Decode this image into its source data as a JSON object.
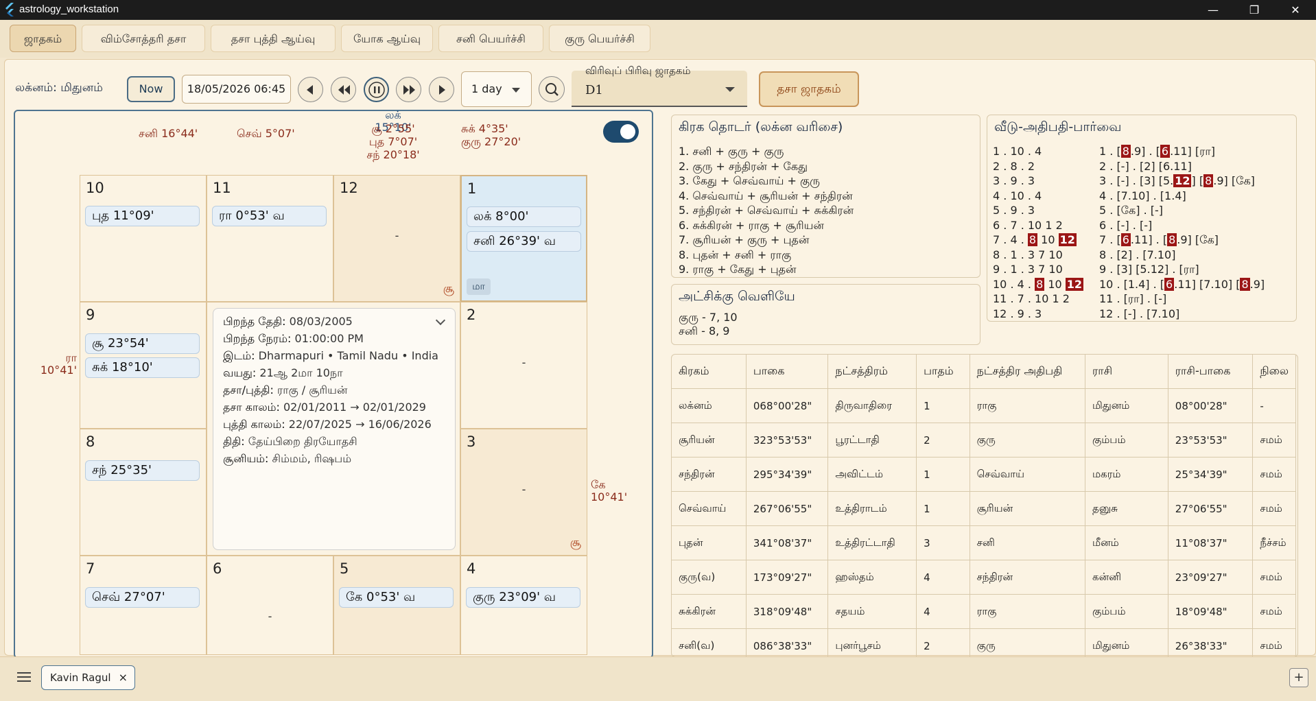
{
  "window": {
    "title": "astrology_workstation",
    "min": "—",
    "max": "❐",
    "close": "✕"
  },
  "tabs": [
    "ஜாதகம்",
    "விம்சோத்தரி தசா",
    "தசா புத்தி ஆய்வு",
    "யோக ஆய்வு",
    "சனி பெயர்ச்சி",
    "குரு பெயர்ச்சி"
  ],
  "toolbar": {
    "lagna_label": "லக்னம்: மிதுனம்",
    "now_label": "Now",
    "datetime": "18/05/2026 06:45",
    "step": "1 day",
    "varga_label": "விரிவுப் பிரிவு ஜாதகம்",
    "varga_value": "D1",
    "dasa_button": "தசா ஜாதகம்"
  },
  "chart": {
    "outer": {
      "top_left1": "சனி 16°44'",
      "top_left2": "செவ் 5°07'",
      "top_mid": [
        "லக் 15°10'",
        "சூ 2°55'",
        "புத 7°07'",
        "சந் 20°18'"
      ],
      "top_right": [
        "சுக் 4°35'",
        "குரு 27°20'"
      ],
      "left": [
        "ரா",
        "10°41'"
      ],
      "right": [
        "கே",
        "10°41'"
      ]
    },
    "houses": {
      "h10": {
        "num": "10",
        "chips": [
          "புத 11°09'"
        ]
      },
      "h11": {
        "num": "11",
        "chips": [
          "ரா 0°53' வ"
        ]
      },
      "h12": {
        "num": "12",
        "dash": "-",
        "corner": "சூ"
      },
      "h1": {
        "num": "1",
        "chips": [
          "லக் 8°00'",
          "சனி 26°39' வ"
        ],
        "badge": "மா"
      },
      "h9": {
        "num": "9",
        "chips": [
          "சூ 23°54'",
          "சுக் 18°10'"
        ]
      },
      "h2": {
        "num": "2",
        "dash": "-"
      },
      "h8": {
        "num": "8",
        "chips": [
          "சந் 25°35'"
        ]
      },
      "h3": {
        "num": "3",
        "dash": "-",
        "corner": "சூ"
      },
      "h7": {
        "num": "7",
        "chips": [
          "செவ் 27°07'"
        ]
      },
      "h6": {
        "num": "6",
        "dash": "-"
      },
      "h5": {
        "num": "5",
        "chips": [
          "கே 0°53' வ"
        ]
      },
      "h4": {
        "num": "4",
        "chips": [
          "குரு 23°09' வ"
        ]
      }
    },
    "info": {
      "dob_k": "பிறந்த தேதி:",
      "dob_v": "08/03/2005",
      "tob_k": "பிறந்த நேரம்:",
      "tob_v": "01:00:00 PM",
      "place_k": "இடம்:",
      "place_v": "Dharmapuri • Tamil Nadu • India",
      "age_k": "வயது:",
      "age_v": "21ஆ 2மா 10நா",
      "dasa_k": "தசா/புத்தி:",
      "dasa_v": "ராகு / சூரியன்",
      "dasaperiod_k": "தசா காலம்:",
      "dasaperiod_v": "02/01/2011 → 02/01/2029",
      "bhukti_k": "புத்தி காலம்:",
      "bhukti_v": "22/07/2025 → 16/06/2026",
      "tithi_k": "திதி:",
      "tithi_v": "தேய்பிறை திரயோதசி",
      "sunya_k": "சூனியம்:",
      "sunya_v": "சிம்மம், ரிஷபம்"
    }
  },
  "graha_thodar": {
    "title": "கிரக தொடர் (லக்ன வரிசை)",
    "items": [
      "1. சனி + குரு + குரு",
      "2. குரு + சந்திரன் + கேது",
      "3. கேது + செவ்வாய் + குரு",
      "4. செவ்வாய் + சூரியன் + சந்திரன்",
      "5. சந்திரன் + செவ்வாய் + சுக்கிரன்",
      "6. சுக்கிரன் + ராகு + சூரியன்",
      "7. சூரியன் + குரு + புதன்",
      "8. புதன் + சனி + ராகு",
      "9. ராகு + கேது + புதன்"
    ]
  },
  "atchikku": {
    "title": "அட்சிக்கு வெளியே",
    "items": [
      "குரு - 7, 10",
      "சனி - 8, 9"
    ]
  },
  "veedu": {
    "title": "வீடு-அதிபதி-பார்வை",
    "left": [
      "1 . 10 . 4",
      "2 . 8 . 2",
      "3 . 9 . 3",
      "4 . 10 . 4",
      "5 . 9 . 3",
      "6 . 7 . 10 1 2",
      "7 . 4 .",
      "8 . 1 . 3 7 10",
      "9 . 1 . 3 7 10",
      "10 . 4 .",
      "11 . 7 . 10 1 2",
      "12 . 9 . 3"
    ],
    "left7_hl1": "8",
    "left7_mid": " 10 ",
    "left7_hl2": "12",
    "left10_hl1": "8",
    "left10_mid": " 10 ",
    "left10_hl2": "12",
    "right": {
      "r1a": "1 . [",
      "r1b": "8",
      "r1c": ".9] . [",
      "r1d": "6",
      "r1e": ".11] [ரா]",
      "r2": "2 . [-] . [2] [6.11]",
      "r3a": "3 . [-] . [3] [5.",
      "r3b": "12",
      "r3c": "] [",
      "r3d": "8",
      "r3e": ".9] [கே]",
      "r4": "4 . [7.10] . [1.4]",
      "r5": "5 . [கே] . [-]",
      "r6": "6 . [-] . [-]",
      "r7a": "7 . [",
      "r7b": "6",
      "r7c": ".11] . [",
      "r7d": "8",
      "r7e": ".9] [கே]",
      "r8": "8 . [2] . [7.10]",
      "r9": "9 . [3] [5.12] . [ரா]",
      "r10a": "10 . [1.4] . [",
      "r10b": "6",
      "r10c": ".11] [7.10] [",
      "r10d": "8",
      "r10e": ".9]",
      "r11": "11 . [ரா] . [-]",
      "r12": "12 . [-] . [7.10]"
    }
  },
  "table": {
    "headers": [
      "கிரகம்",
      "பாகை",
      "நட்சத்திரம்",
      "பாதம்",
      "நட்சத்திர அதிபதி",
      "ராசி",
      "ராசி-பாகை",
      "நிலை"
    ],
    "rows": [
      [
        "லக்னம்",
        "068°00'28\"",
        "திருவாதிரை",
        "1",
        "ராகு",
        "மிதுனம்",
        "08°00'28\"",
        "-"
      ],
      [
        "சூரியன்",
        "323°53'53\"",
        "பூரட்டாதி",
        "2",
        "குரு",
        "கும்பம்",
        "23°53'53\"",
        "சமம்"
      ],
      [
        "சந்திரன்",
        "295°34'39\"",
        "அவிட்டம்",
        "1",
        "செவ்வாய்",
        "மகரம்",
        "25°34'39\"",
        "சமம்"
      ],
      [
        "செவ்வாய்",
        "267°06'55\"",
        "உத்திராடம்",
        "1",
        "சூரியன்",
        "தனுசு",
        "27°06'55\"",
        "சமம்"
      ],
      [
        "புதன்",
        "341°08'37\"",
        "உத்திரட்டாதி",
        "3",
        "சனி",
        "மீனம்",
        "11°08'37\"",
        "நீச்சம்"
      ],
      [
        "குரு(வ)",
        "173°09'27\"",
        "ஹஸ்தம்",
        "4",
        "சந்திரன்",
        "கன்னி",
        "23°09'27\"",
        "சமம்"
      ],
      [
        "சுக்கிரன்",
        "318°09'48\"",
        "சதயம்",
        "4",
        "ராகு",
        "கும்பம்",
        "18°09'48\"",
        "சமம்"
      ],
      [
        "சனி(வ)",
        "086°38'33\"",
        "புனர்பூசம்",
        "2",
        "குரு",
        "மிதுனம்",
        "26°38'33\"",
        "சமம்"
      ]
    ]
  },
  "bottom": {
    "user": "Kavin Ragul",
    "close": "×",
    "plus": "+"
  }
}
